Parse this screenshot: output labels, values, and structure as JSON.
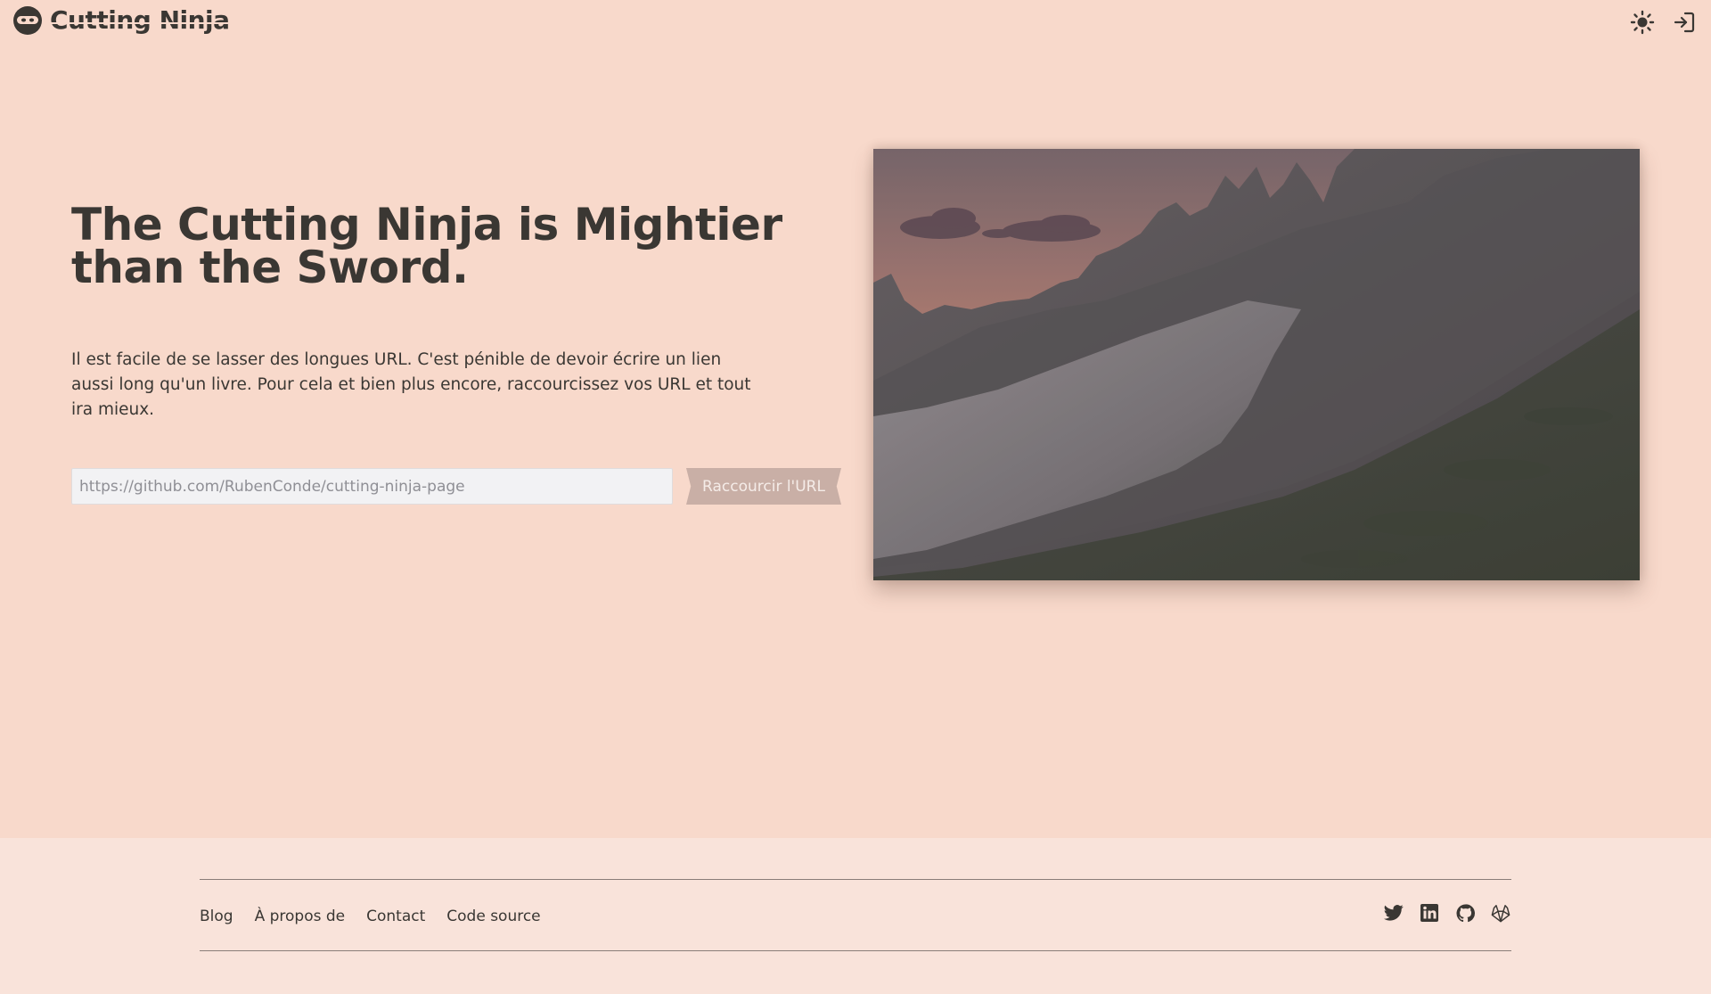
{
  "header": {
    "brand": "Cutting Ninja",
    "theme_icon": "sun-icon",
    "login_icon": "sign-in-icon"
  },
  "hero": {
    "title": "The Cutting Ninja is Mightier than the Sword.",
    "description": "Il est facile de se lasser des longues URL. C'est pénible de devoir écrire un lien aussi long qu'un livre. Pour cela et bien plus encore, raccourcissez vos URL et tout ira mieux.",
    "input_placeholder": "https://github.com/RubenConde/cutting-ninja-page",
    "input_value": "",
    "button_label": "Raccourcir l'URL",
    "image_subject": "mountain-ridge-at-sunset"
  },
  "footer": {
    "links": [
      "Blog",
      "À propos de",
      "Contact",
      "Code source"
    ],
    "socials": [
      "twitter-icon",
      "linkedin-icon",
      "github-icon",
      "gitlab-icon"
    ]
  },
  "colors": {
    "background": "#f8d9cb",
    "footer_background": "#f9e3da",
    "text": "#3a3733",
    "button": "#c9afa6",
    "input": "#f2f2f4"
  }
}
